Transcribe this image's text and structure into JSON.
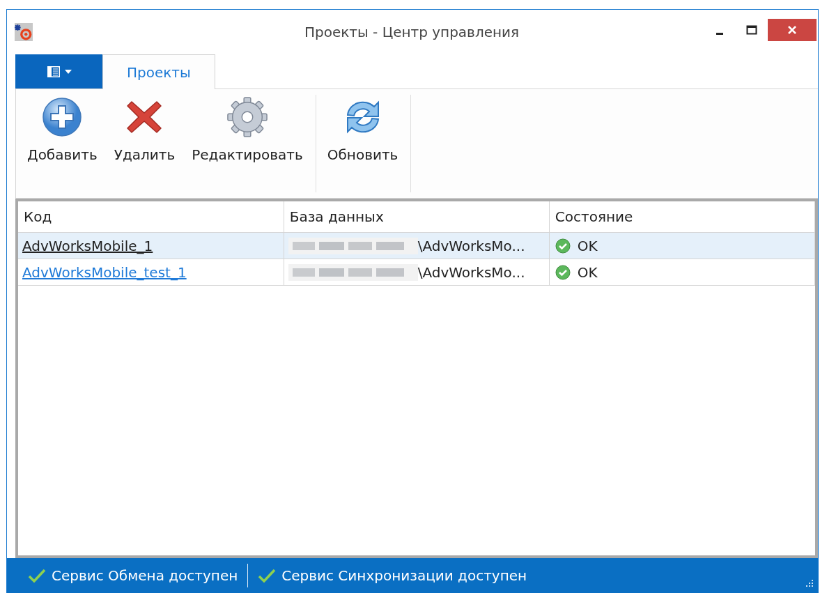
{
  "window": {
    "title": "Проекты - Центр управления"
  },
  "tabs": [
    {
      "label": "Проекты",
      "selected": true
    }
  ],
  "toolbar": {
    "groups": [
      [
        {
          "kind": "add",
          "label": "Добавить"
        },
        {
          "kind": "delete",
          "label": "Удалить"
        },
        {
          "kind": "edit",
          "label": "Редактировать"
        }
      ],
      [
        {
          "kind": "refresh",
          "label": "Обновить"
        }
      ]
    ]
  },
  "table": {
    "columns": [
      "Код",
      "База данных",
      "Состояние"
    ],
    "rows": [
      {
        "code": "AdvWorksMobile_1",
        "database": "\\AdvWorksMo...",
        "status": "OK",
        "selected": true,
        "hovered": false
      },
      {
        "code": "AdvWorksMobile_test_1",
        "database": "\\AdvWorksMo...",
        "status": "OK",
        "selected": false,
        "hovered": true
      }
    ]
  },
  "status_bar": [
    {
      "text": "Сервис Обмена доступен",
      "ok": true
    },
    {
      "text": "Сервис Синхронизации доступен",
      "ok": true
    }
  ]
}
